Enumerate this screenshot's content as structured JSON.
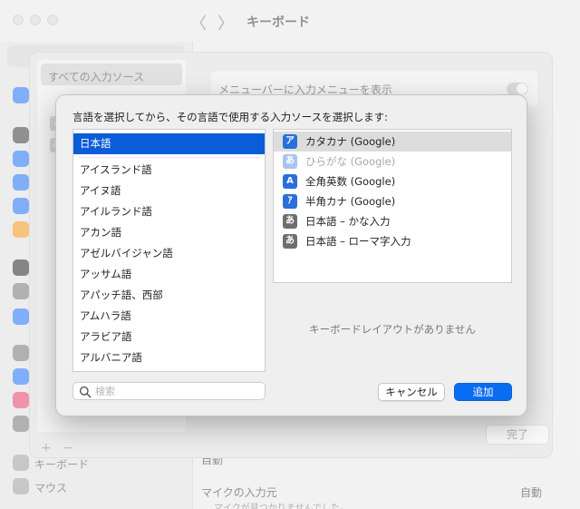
{
  "window": {
    "title": "キーボード",
    "back_arrow": "〈",
    "forward_arrow": "〉"
  },
  "sidebar": {
    "items": [
      {
        "label": "キーボード",
        "icon": "keyboard-icon"
      },
      {
        "label": "マウス",
        "icon": "mouse-icon"
      }
    ]
  },
  "content": {
    "dictation_row_label": "自動",
    "mic_label": "マイクの入力元",
    "mic_value": "自動",
    "mic_warning": "マイクが見つかりませんでした。"
  },
  "input_sources_sheet": {
    "list_selected": "すべての入力ソース",
    "show_menu_label": "メニューバーに入力メニューを表示",
    "done_label": "完了",
    "plus": "+",
    "minus": "−"
  },
  "dialog": {
    "prompt": "言語を選択してから、その言語で使用する入力ソースを選択します:",
    "languages": {
      "selected": "日本語",
      "items": [
        "アイスランド語",
        "アイヌ語",
        "アイルランド語",
        "アカン語",
        "アゼルバイジャン語",
        "アッサム語",
        "アパッチ語、西部",
        "アムハラ語",
        "アラビア語",
        "アルバニア語"
      ]
    },
    "sources": [
      {
        "label": "カタカナ (Google)",
        "icon_glyph": "ア",
        "icon_color": "#2a6fdb",
        "state": "highlighted"
      },
      {
        "label": "ひらがな (Google)",
        "icon_glyph": "あ",
        "icon_color": "#a9c4ee",
        "state": "disabled"
      },
      {
        "label": "全角英数 (Google)",
        "icon_glyph": "A",
        "icon_color": "#2a6fdb",
        "state": "normal"
      },
      {
        "label": "半角カナ (Google)",
        "icon_glyph": "ｱ",
        "icon_color": "#2a6fdb",
        "state": "normal"
      },
      {
        "label": "日本語 – かな入力",
        "icon_glyph": "あ",
        "icon_color": "#6e6e6e",
        "state": "normal"
      },
      {
        "label": "日本語 – ローマ字入力",
        "icon_glyph": "あ",
        "icon_color": "#6e6e6e",
        "state": "normal"
      }
    ],
    "no_layout_text": "キーボードレイアウトがありません",
    "search_placeholder": "検索",
    "cancel_label": "キャンセル",
    "add_label": "追加",
    "accent_color": "#0a6cf0"
  }
}
